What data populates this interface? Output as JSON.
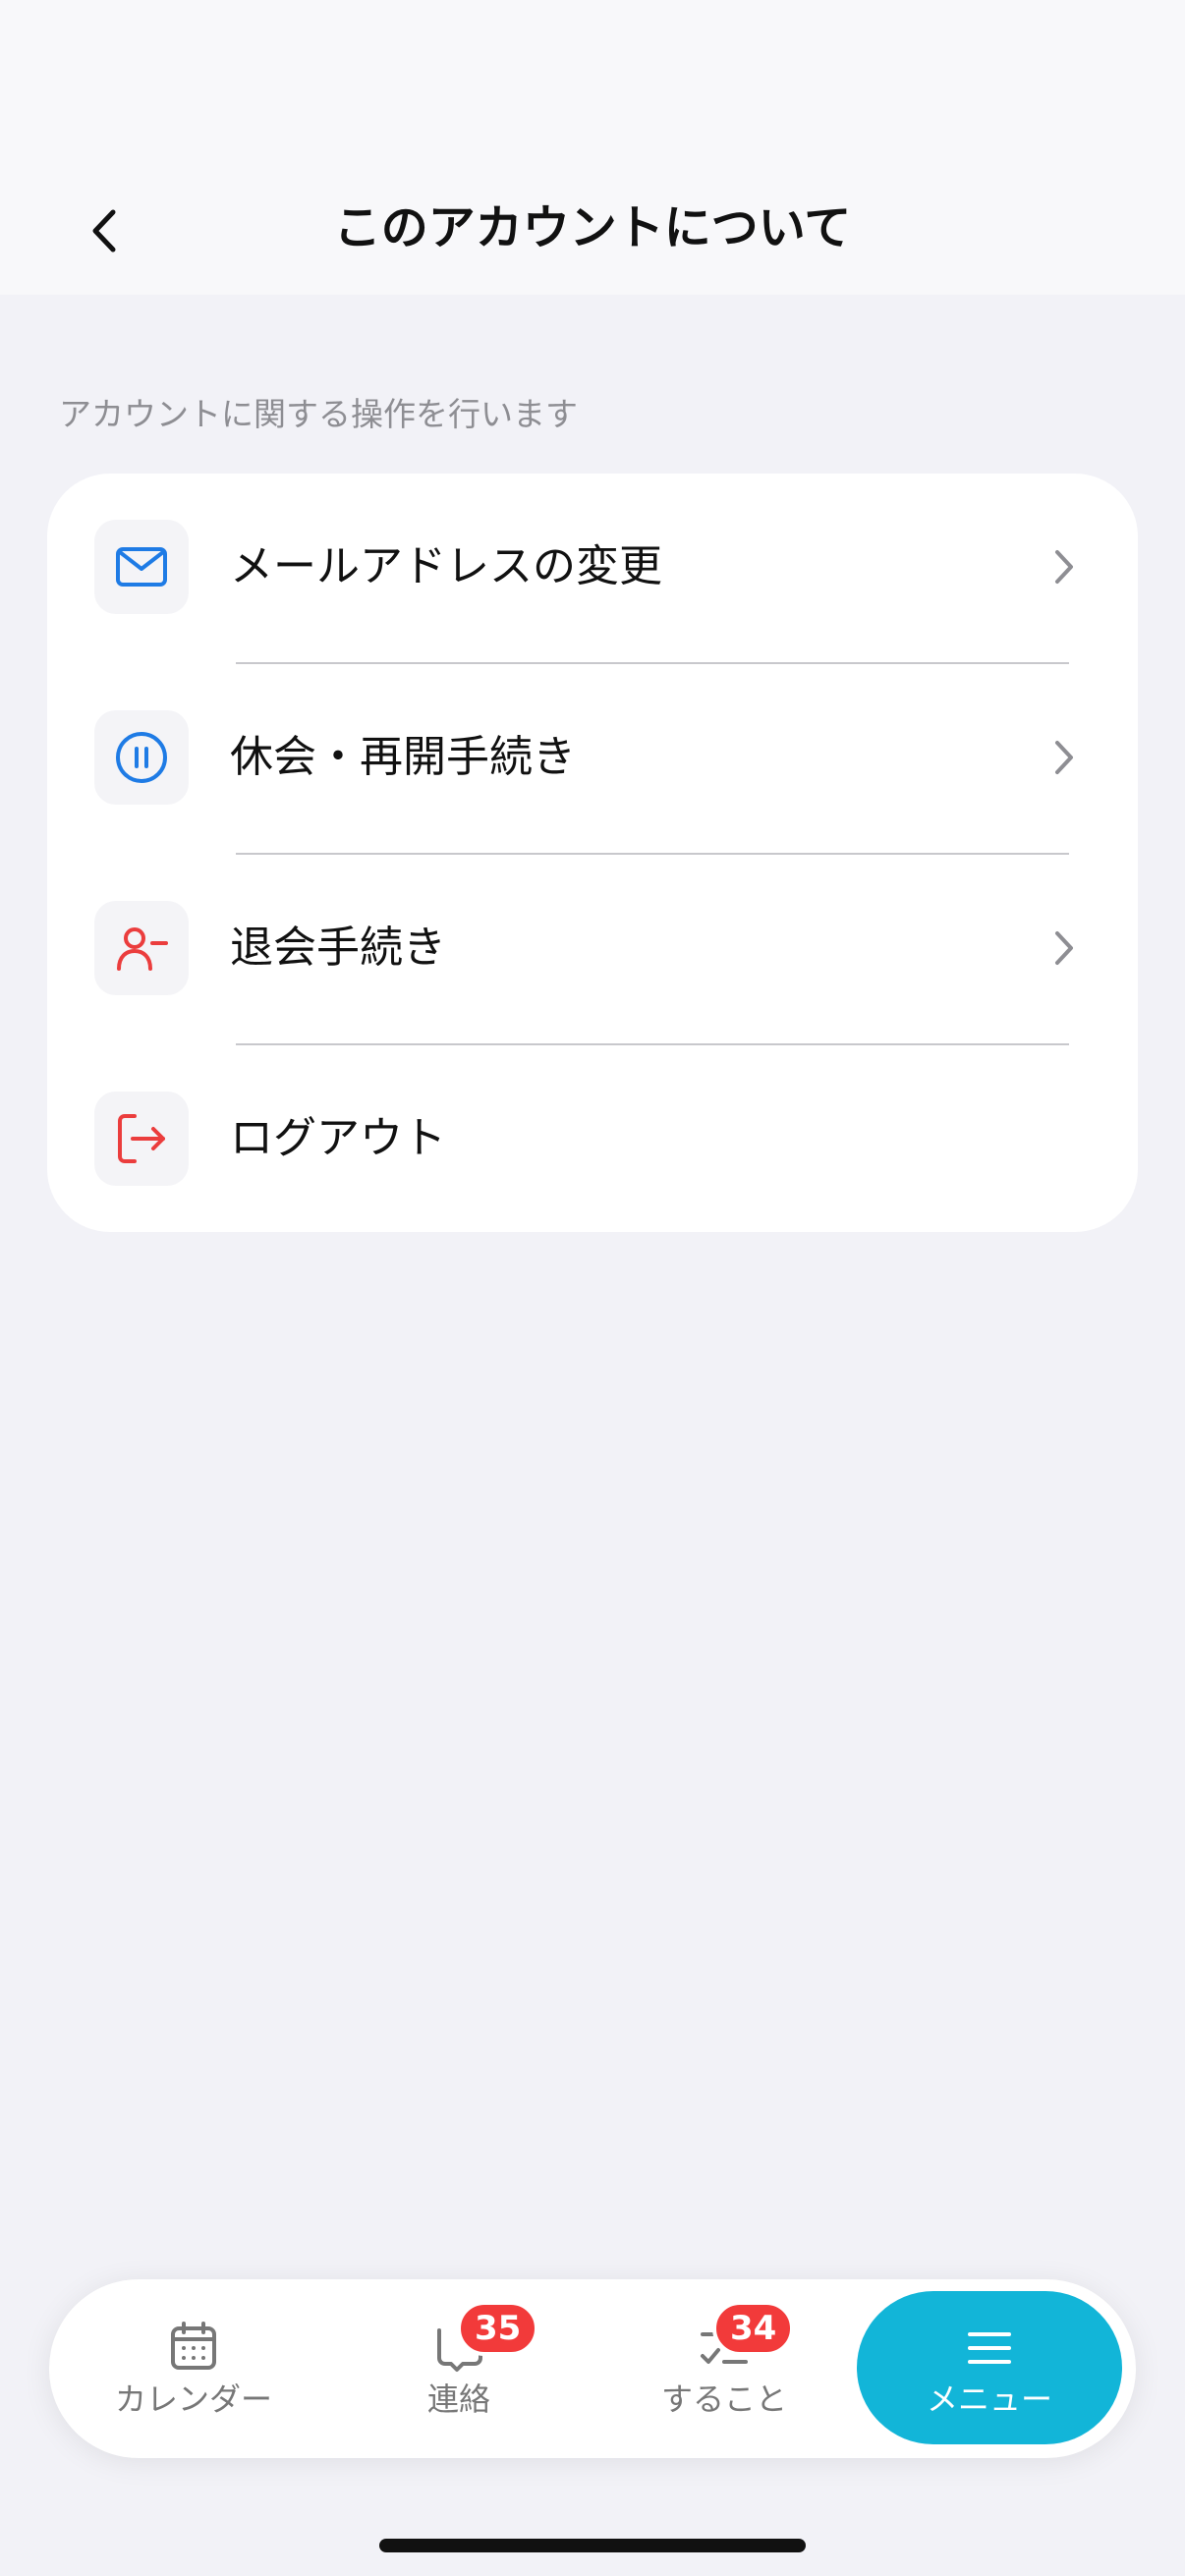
{
  "header": {
    "title": "このアカウントについて",
    "back_icon": "chevron-left-icon"
  },
  "section": {
    "caption": "アカウントに関する操作を行います"
  },
  "menu": {
    "items": [
      {
        "label": "メールアドレスの変更",
        "icon": "mail-icon",
        "icon_color": "#1E7BE5",
        "has_chevron": true
      },
      {
        "label": "休会・再開手続き",
        "icon": "pause-circle-icon",
        "icon_color": "#1E7BE5",
        "has_chevron": true
      },
      {
        "label": "退会手続き",
        "icon": "user-minus-icon",
        "icon_color": "#EB3D3D",
        "has_chevron": true
      },
      {
        "label": "ログアウト",
        "icon": "logout-icon",
        "icon_color": "#EB3D3D",
        "has_chevron": false
      }
    ]
  },
  "tabbar": {
    "tabs": [
      {
        "label": "カレンダー",
        "icon": "calendar-icon",
        "badge": null,
        "active": false
      },
      {
        "label": "連絡",
        "icon": "chat-icon",
        "badge": "35",
        "active": false
      },
      {
        "label": "すること",
        "icon": "checklist-icon",
        "badge": "34",
        "active": false
      },
      {
        "label": "メニュー",
        "icon": "menu-icon",
        "badge": null,
        "active": true
      }
    ],
    "accent_color": "#12B5D8",
    "badge_color": "#F23A3A"
  }
}
